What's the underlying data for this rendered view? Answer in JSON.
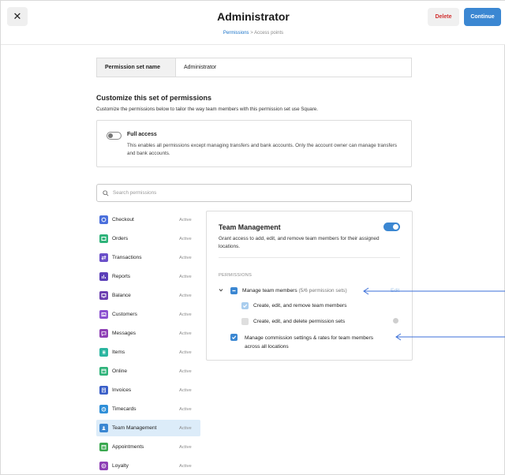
{
  "header": {
    "close_glyph": "✕",
    "title": "Administrator",
    "breadcrumb": {
      "active": "Permissions",
      "separator": ">",
      "inactive": "Access points"
    },
    "delete_label": "Delete",
    "continue_label": "Continue"
  },
  "name_field": {
    "label": "Permission set name",
    "value": "Administrator"
  },
  "customize": {
    "title": "Customize this set of permissions",
    "subtitle": "Customize the permissions below to tailor the way team members with this permission set use Square."
  },
  "full_access": {
    "title": "Full access",
    "description": "This enables all permissions except managing transfers and bank accounts. Only the account owner can manage transfers and bank accounts.",
    "enabled": false
  },
  "search": {
    "placeholder": "Search permissions"
  },
  "sidebar": {
    "items": [
      {
        "label": "Checkout",
        "status": "Active",
        "icon": "checkout-icon",
        "color": "#4a6fdc"
      },
      {
        "label": "Orders",
        "status": "Active",
        "icon": "orders-icon",
        "color": "#2fb37a"
      },
      {
        "label": "Transactions",
        "status": "Active",
        "icon": "transactions-icon",
        "color": "#6a4fc9"
      },
      {
        "label": "Reports",
        "status": "Active",
        "icon": "reports-icon",
        "color": "#5b3fb8"
      },
      {
        "label": "Balance",
        "status": "Active",
        "icon": "balance-icon",
        "color": "#6b3fb0"
      },
      {
        "label": "Customers",
        "status": "Active",
        "icon": "customers-icon",
        "color": "#8a4fcf"
      },
      {
        "label": "Messages",
        "status": "Active",
        "icon": "messages-icon",
        "color": "#8e3fb5"
      },
      {
        "label": "Items",
        "status": "Active",
        "icon": "items-icon",
        "color": "#2ab5a0"
      },
      {
        "label": "Online",
        "status": "Active",
        "icon": "online-icon",
        "color": "#2fb37a"
      },
      {
        "label": "Invoices",
        "status": "Active",
        "icon": "invoices-icon",
        "color": "#3a5fc8"
      },
      {
        "label": "Timecards",
        "status": "Active",
        "icon": "timecards-icon",
        "color": "#2f8fd8"
      },
      {
        "label": "Team Management",
        "status": "Active",
        "icon": "team-management-icon",
        "color": "#3b87d2",
        "selected": true
      },
      {
        "label": "Appointments",
        "status": "Active",
        "icon": "appointments-icon",
        "color": "#3aa84f"
      },
      {
        "label": "Loyalty",
        "status": "Active",
        "icon": "loyalty-icon",
        "color": "#8e3fb5"
      }
    ]
  },
  "panel": {
    "title": "Team Management",
    "enabled": true,
    "description": "Grant access to add, edit, and remove team members for their assigned locations.",
    "permissions_heading": "PERMISSIONS",
    "manage_team": {
      "label": "Manage team members",
      "count": "(5/6 permission sets)",
      "edit_label": "Edit"
    },
    "sub_items": [
      {
        "label": "Create, edit, and remove team members",
        "checked": true
      },
      {
        "label": "Create, edit, and delete permission sets",
        "checked": false
      }
    ],
    "commission": {
      "label_line1": "Manage commission settings & rates for team members",
      "label_line2": "across all locations",
      "checked": true
    }
  },
  "colors": {
    "accent": "#3b87d2",
    "danger": "#d12f2f",
    "annotation_arrow": "#3b6fd8"
  }
}
